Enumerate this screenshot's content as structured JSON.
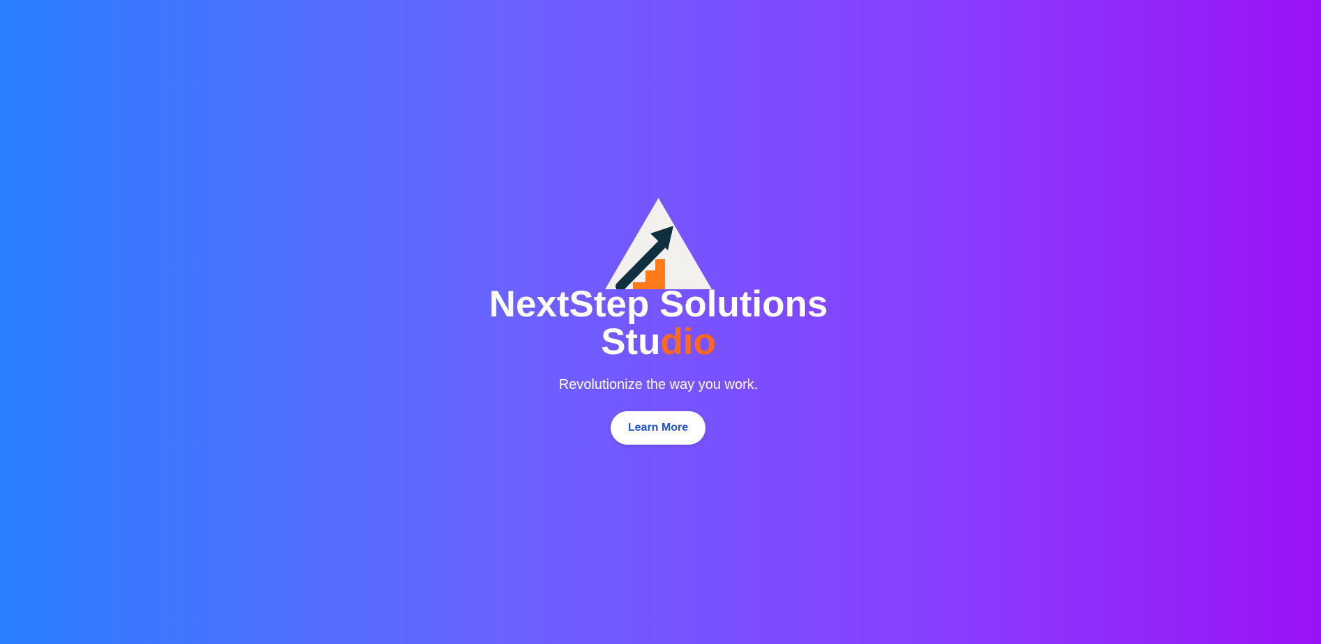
{
  "hero": {
    "title_main": "NextStep Solutions",
    "title_part1": "Stu",
    "title_part2": "dio",
    "tagline": "Revolutionize the way you work.",
    "cta_label": "Learn More"
  },
  "logo": {
    "icon": "rising-arrow-triangle-icon",
    "colors": {
      "triangle": "#f2f1ee",
      "arrow": "#10303f",
      "steps": "#ff7a1a"
    }
  },
  "colors": {
    "gradient_start": "#2a80ff",
    "gradient_end": "#9a12f7",
    "accent": "#ff6a1a",
    "button_text": "#1d52d6"
  }
}
